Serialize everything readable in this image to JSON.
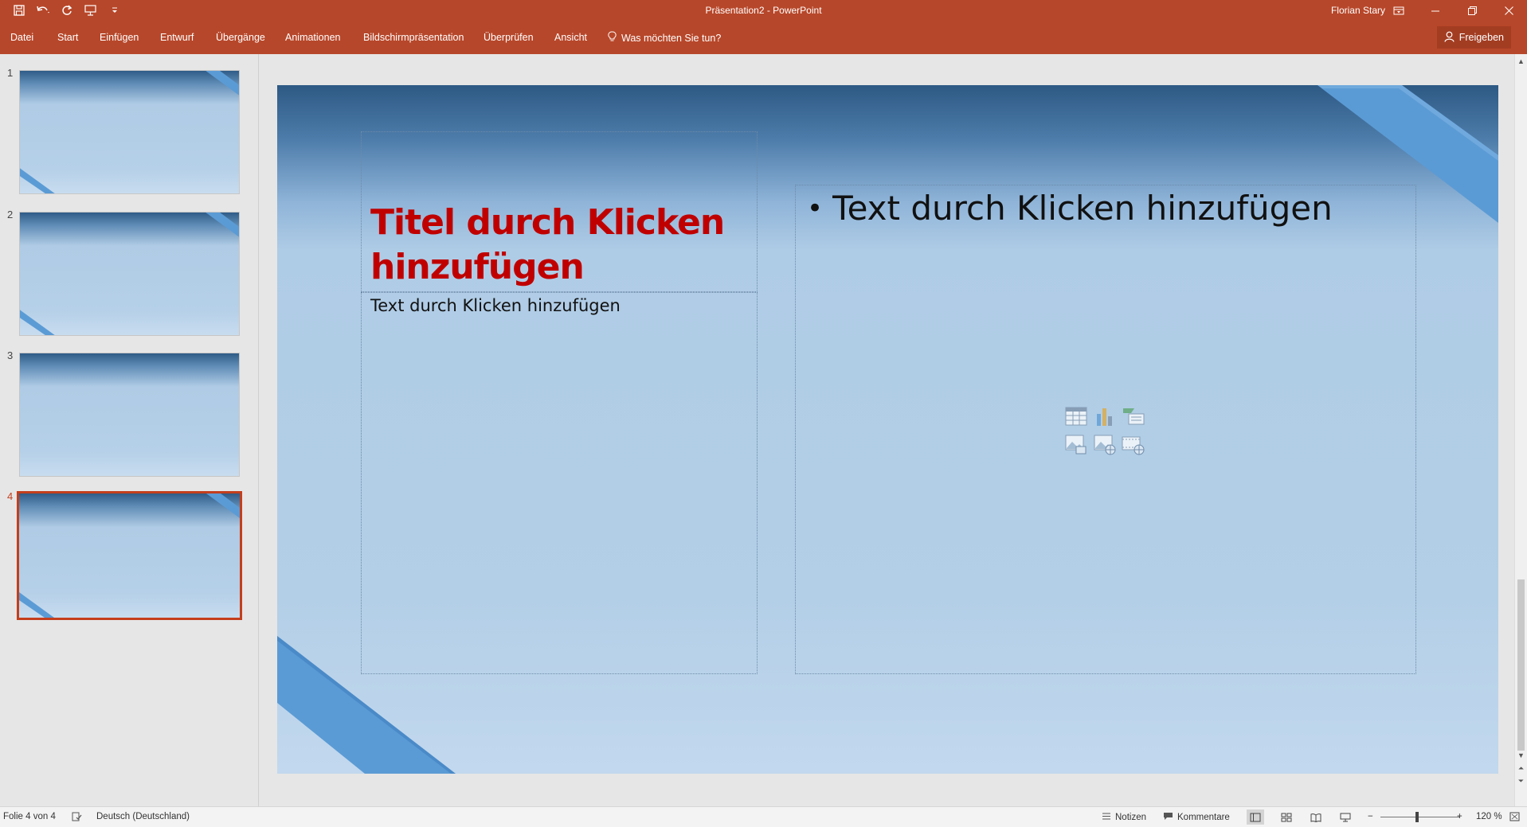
{
  "window": {
    "title": "Präsentation2 - PowerPoint",
    "user": "Florian Stary",
    "qat": [
      "save-icon",
      "undo-icon",
      "redo-icon",
      "start-from-beginning-icon",
      "customize-qat-icon"
    ]
  },
  "ribbon": {
    "tabs": [
      "Datei",
      "Start",
      "Einfügen",
      "Entwurf",
      "Übergänge",
      "Animationen",
      "Bildschirmpräsentation",
      "Überprüfen",
      "Ansicht"
    ],
    "tell_me": "Was möchten Sie tun?",
    "share": "Freigeben"
  },
  "thumbnails": [
    {
      "number": "1",
      "active": false
    },
    {
      "number": "2",
      "active": false
    },
    {
      "number": "3",
      "active": false
    },
    {
      "number": "4",
      "active": true
    }
  ],
  "slide": {
    "title": "Titel durch Klicken hinzufügen",
    "subtitle": "Text durch Klicken hinzufügen",
    "content_bullet": "Text durch Klicken hinzufügen",
    "insert_icons": [
      "insert-table-icon",
      "insert-chart-icon",
      "insert-smartart-icon",
      "insert-picture-icon",
      "online-pictures-icon",
      "insert-video-icon"
    ]
  },
  "statusbar": {
    "slide_info": "Folie 4 von 4",
    "language": "Deutsch (Deutschland)",
    "notes": "Notizen",
    "comments": "Kommentare",
    "zoom_minus": "−",
    "zoom_plus": "+",
    "zoom": "120 %"
  },
  "colors": {
    "accent": "#b7472a",
    "title_red": "#c00000",
    "selection": "#c43e1c",
    "ribbon_stripe": "#5b9bd5"
  }
}
